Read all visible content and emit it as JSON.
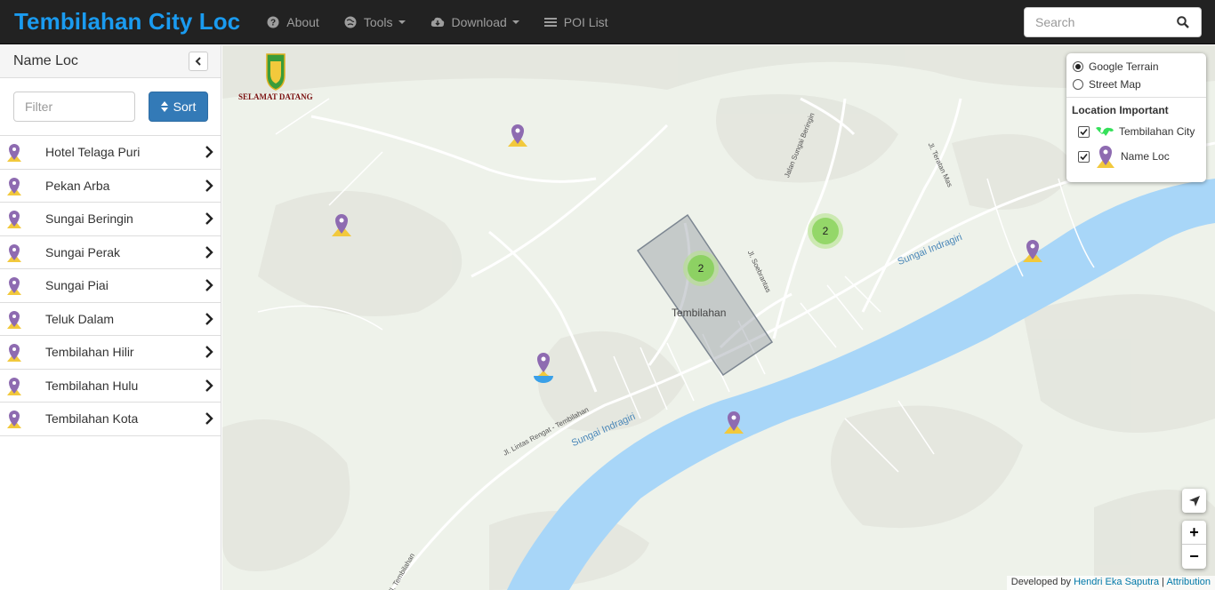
{
  "navbar": {
    "brand": "Tembilahan City Loc",
    "items": [
      {
        "label": "About",
        "icon": "question-circle-icon",
        "dropdown": false
      },
      {
        "label": "Tools",
        "icon": "globe-icon",
        "dropdown": true
      },
      {
        "label": "Download",
        "icon": "cloud-download-icon",
        "dropdown": true
      },
      {
        "label": "POI List",
        "icon": "list-icon",
        "dropdown": false
      }
    ],
    "search_placeholder": "Search"
  },
  "sidebar": {
    "title": "Name Loc",
    "filter_placeholder": "Filter",
    "sort_label": "Sort",
    "items": [
      {
        "label": "Hotel Telaga Puri"
      },
      {
        "label": "Pekan Arba"
      },
      {
        "label": "Sungai Beringin"
      },
      {
        "label": "Sungai Perak"
      },
      {
        "label": "Sungai Piai"
      },
      {
        "label": "Teluk Dalam"
      },
      {
        "label": "Tembilahan Hilir"
      },
      {
        "label": "Tembilahan Hulu"
      },
      {
        "label": "Tembilahan Kota"
      }
    ]
  },
  "map": {
    "city_label": "Tembilahan",
    "river_labels": [
      "Sungai Indragiri",
      "Sungai Indragiri"
    ],
    "road_labels": [
      "Jalan Sungai Beringin",
      "Jl. Teratan Mas",
      "Jl. Soebrantas",
      "Jl. Lintas Rengat - Tembilahan",
      "Jl. Tembilahan"
    ],
    "logo_text": "SELAMAT DATANG",
    "clusters": [
      {
        "count": "2"
      },
      {
        "count": "2"
      }
    ],
    "layers": {
      "base": [
        {
          "label": "Google Terrain",
          "selected": true
        },
        {
          "label": "Street Map",
          "selected": false
        }
      ],
      "group_title": "Location Important",
      "overlays": [
        {
          "label": "Tembilahan City",
          "checked": true
        },
        {
          "label": "Name Loc",
          "checked": true
        }
      ]
    },
    "zoom_in": "+",
    "zoom_out": "−",
    "attribution": {
      "prefix": "Developed by",
      "author": "Hendri Eka Saputra",
      "separator": "|",
      "link": "Attribution"
    }
  },
  "colors": {
    "brand": "#1a9bf0",
    "navbar_bg": "#222222",
    "river": "#a8d6f8",
    "marker_pin": "#8e6bb1",
    "marker_base": "#f2c93c",
    "sort_button": "#337ab7"
  }
}
